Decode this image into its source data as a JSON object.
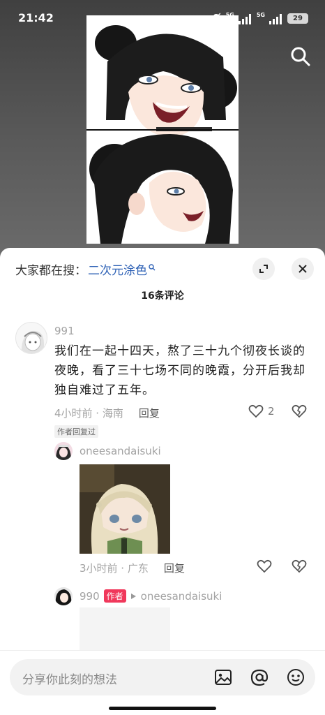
{
  "status_bar": {
    "time": "21:42",
    "network_label_1": "5G",
    "network_label_2": "5G",
    "battery": "29"
  },
  "top": {
    "search_icon": "search-icon"
  },
  "sheet": {
    "hot_search_prefix": "大家都在搜：",
    "hot_search_keyword": "二次元涂色",
    "comment_count_title": "16条评论"
  },
  "comment": {
    "username": "991",
    "text": "我们在一起十四天，熬了三十九个彻夜长谈的夜晚，看了三十七场不同的晚霞，分开后我却独自难过了五年。",
    "time_location": "4小时前 · 海南",
    "reply_label": "回复",
    "like_count": "2",
    "author_replied_tag": "作者回复过"
  },
  "reply1": {
    "username": "oneesandaisuki",
    "time_location": "3小时前 · 广东",
    "reply_label": "回复"
  },
  "reply2": {
    "username": "990",
    "author_badge": "作者",
    "reply_to": "oneesandaisuki"
  },
  "input_bar": {
    "placeholder": "分享你此刻的想法"
  },
  "colors": {
    "accent_link": "#2f62b6",
    "author_badge": "#f0385b"
  }
}
